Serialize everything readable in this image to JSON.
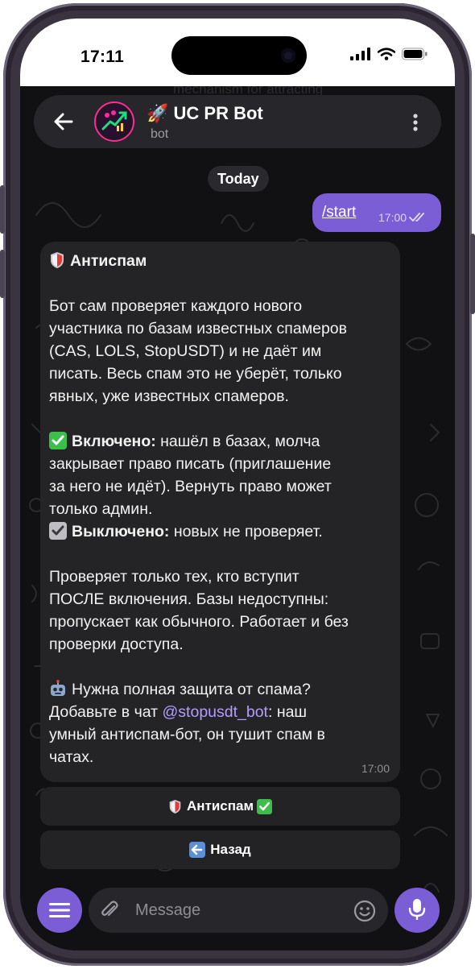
{
  "status_bar": {
    "time": "17:11"
  },
  "header": {
    "title": "🚀 UC PR Bot",
    "subtitle": "bot",
    "ghost_text": "mechanism for attracting"
  },
  "chat": {
    "date_label": "Today",
    "outgoing": {
      "text": "/start",
      "time": "17:00"
    },
    "incoming": {
      "heading": "Антиспам",
      "paragraph1": [
        "Бот сам проверяет каждого нового",
        "участника по базам известных спамеров",
        "(CAS, LOLS, StopUSDT) и не даёт им",
        "писать. Весь спам это не уберёт, только",
        "явных, уже известных спамеров."
      ],
      "enabled_label": "Включено:",
      "enabled_lines": [
        "нашёл в базах, молча",
        "закрывает право писать (приглашение",
        "за него не идёт). Вернуть право может",
        "только админ."
      ],
      "disabled_label": "Выключено:",
      "disabled_text": "новых не проверяет.",
      "paragraph3": [
        "Проверяет только тех, кто вступит",
        "ПОСЛЕ включения. Базы недоступны:",
        "пропускает как обычного. Работает и без",
        "проверки доступа."
      ],
      "promo_line1": "Нужна полная защита от спама?",
      "promo_prefix": "Добавьте в чат",
      "promo_link": "@stopusdt_bot",
      "promo_suffix": ": наш",
      "promo_line3": "умный антиспам-бот, он тушит спам в",
      "promo_line4": "чатах.",
      "time": "17:00"
    },
    "keyboard": [
      {
        "label": "Антиспам"
      },
      {
        "label": "Назад"
      }
    ]
  },
  "composer": {
    "placeholder": "Message"
  },
  "colors": {
    "accent": "#7b5dd6",
    "bubble_in": "#242427",
    "link": "#b49cff",
    "check_green": "#3cbf4a"
  }
}
